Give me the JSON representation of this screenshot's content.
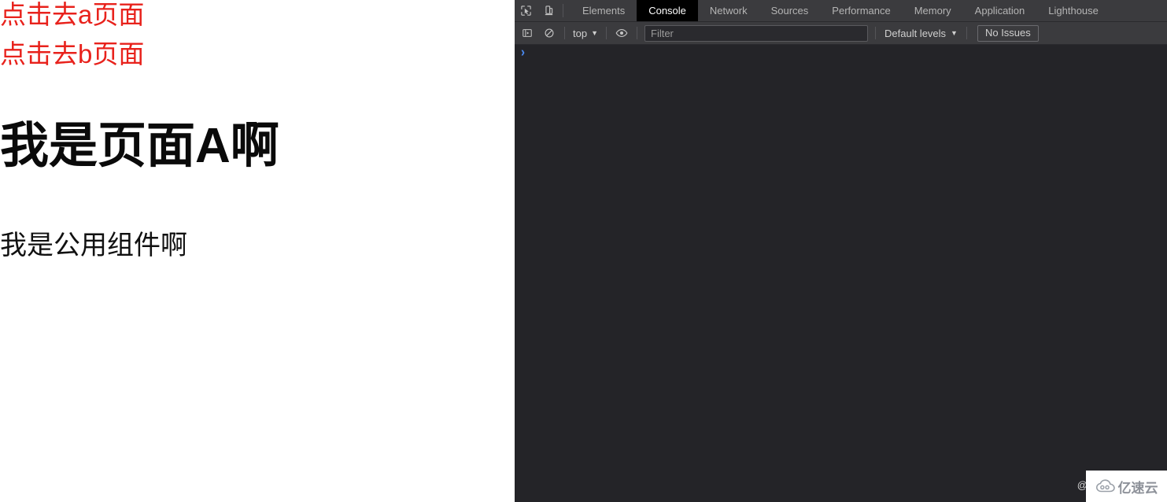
{
  "page": {
    "links": [
      {
        "label": "点击去a页面",
        "name": "link-goto-page-a"
      },
      {
        "label": "点击去b页面",
        "name": "link-goto-page-b"
      }
    ],
    "heading": "我是页面A啊",
    "subtext": "我是公用组件啊",
    "link_color": "#e8221c",
    "heading_color": "#0a0a0a",
    "background": "#ffffff"
  },
  "devtools": {
    "theme": {
      "toolbar_bg": "#3b3b3e",
      "body_bg": "#242428",
      "active_tab_bg": "#000000",
      "text": "#c9c9c9",
      "prompt_color": "#4b8df8"
    },
    "icons": {
      "inspect": "inspect-element-icon",
      "device": "device-toolbar-icon",
      "sidebar": "console-sidebar-icon",
      "clear": "clear-console-icon",
      "eye": "live-expression-eye-icon"
    },
    "tabs": [
      {
        "label": "Elements",
        "active": false
      },
      {
        "label": "Console",
        "active": true
      },
      {
        "label": "Network",
        "active": false
      },
      {
        "label": "Sources",
        "active": false
      },
      {
        "label": "Performance",
        "active": false
      },
      {
        "label": "Memory",
        "active": false
      },
      {
        "label": "Application",
        "active": false
      },
      {
        "label": "Lighthouse",
        "active": false
      }
    ],
    "toolbar": {
      "context": "top",
      "filter_placeholder": "Filter",
      "filter_value": "",
      "levels": "Default levels",
      "issues": "No Issues",
      "caret": "▼"
    },
    "console": {
      "prompt": "›",
      "messages": []
    }
  },
  "watermark": {
    "overlay_text": "@那",
    "brand": "亿速云"
  }
}
